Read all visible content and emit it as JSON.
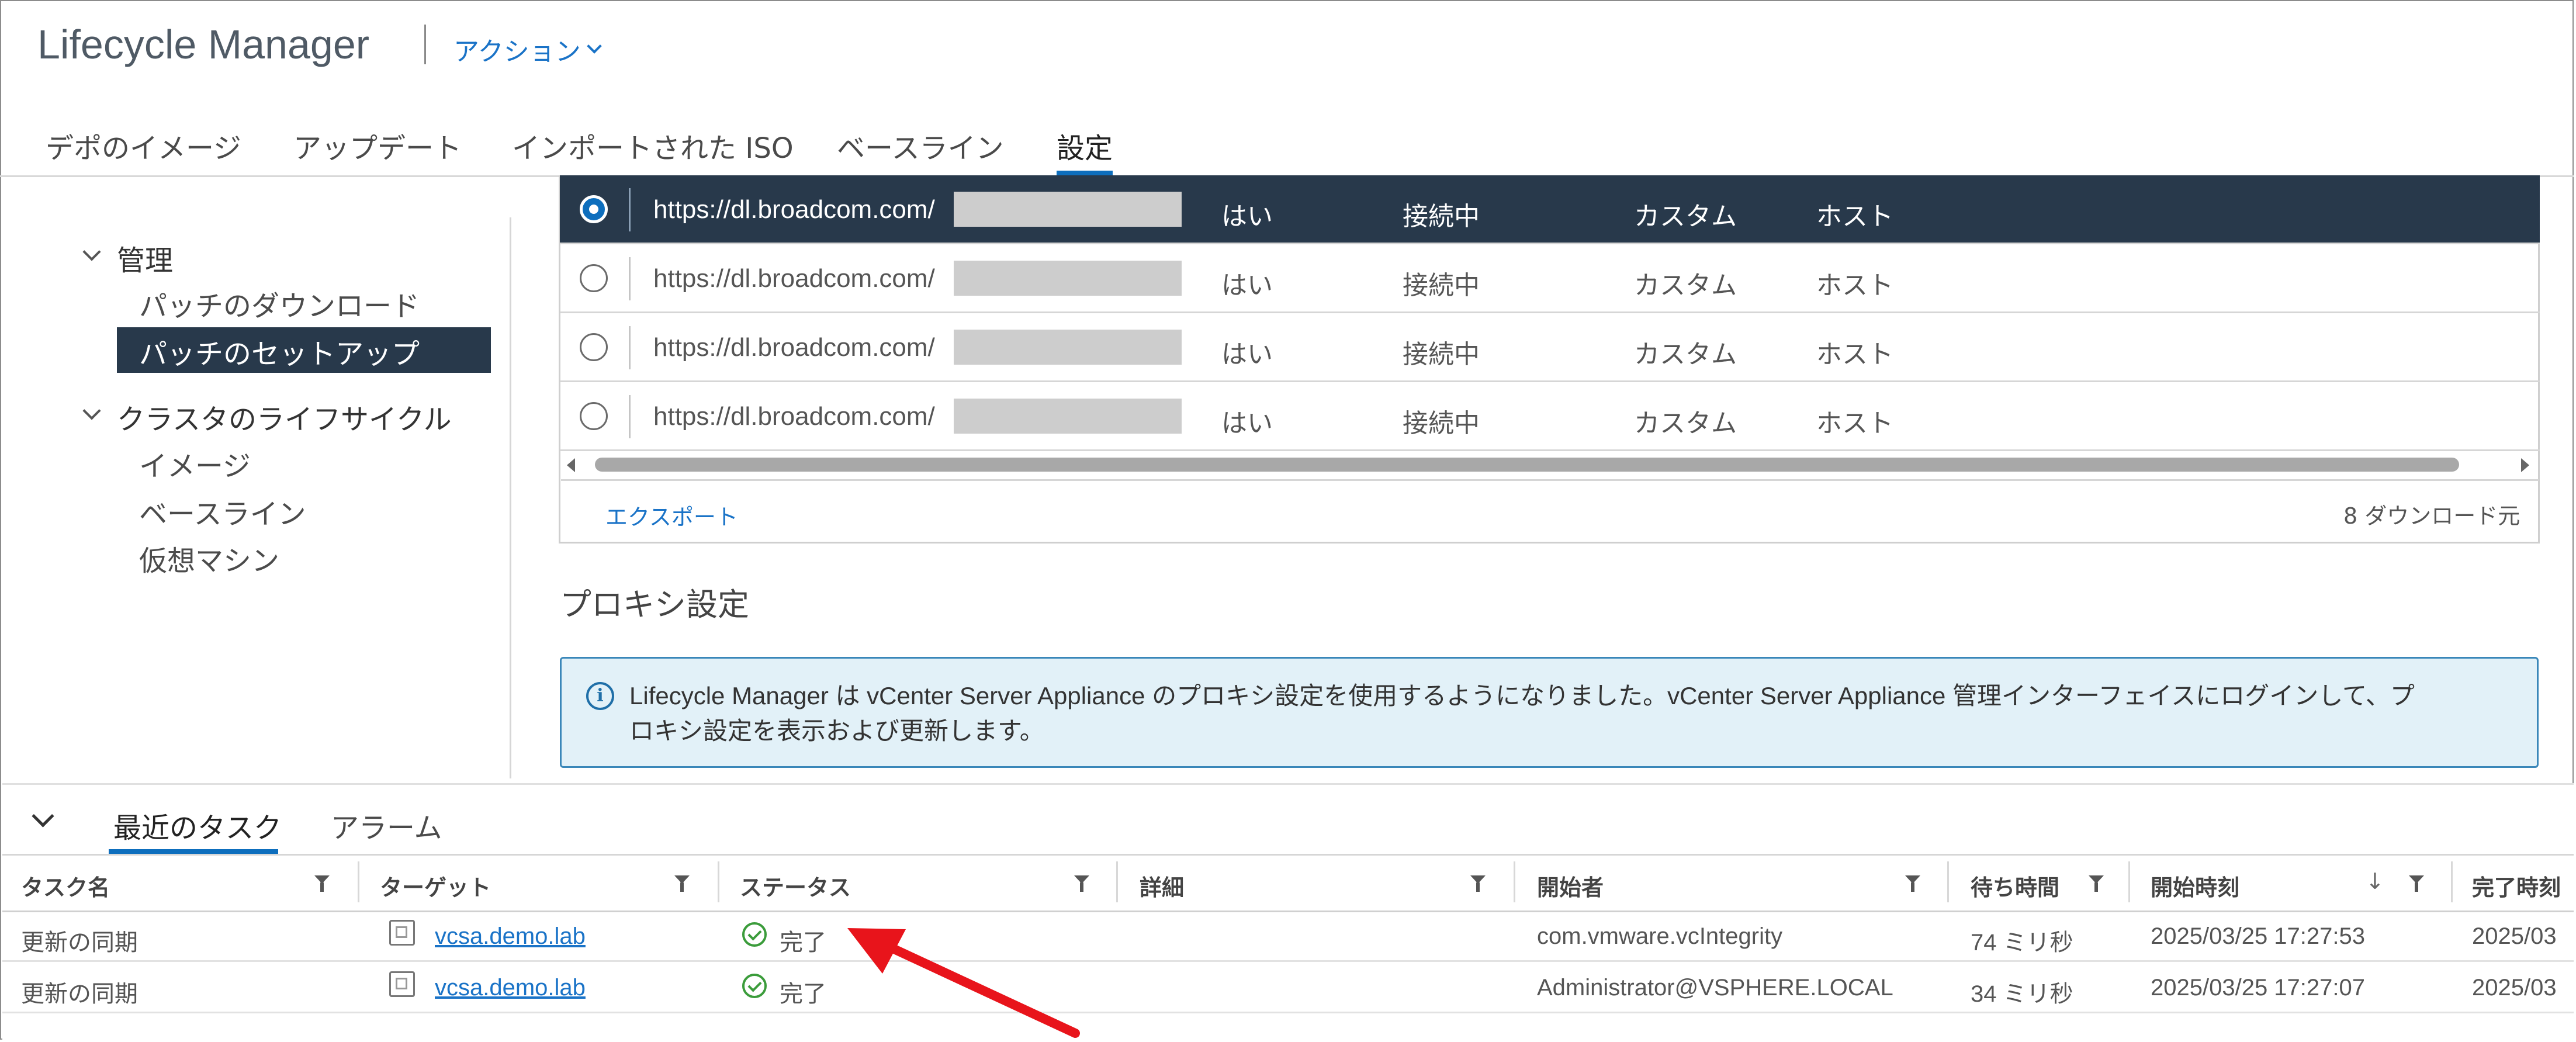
{
  "header": {
    "app_title": "Lifecycle Manager",
    "actions_label": "アクション"
  },
  "tabs": [
    "デポのイメージ",
    "アップデート",
    "インポートされた ISO",
    "ベースライン",
    "設定"
  ],
  "active_tab": "設定",
  "sidebar": {
    "group_admin": "管理",
    "admin_items": [
      "パッチのダウンロード",
      "パッチのセットアップ"
    ],
    "selected_item": "パッチのセットアップ",
    "group_cluster": "クラスタのライフサイクル",
    "cluster_items": [
      "イメージ",
      "ベースライン",
      "仮想マシン"
    ]
  },
  "download_sources": {
    "rows": [
      {
        "url": "https://dl.broadcom.com/",
        "enabled": "はい",
        "status": "接続中",
        "type": "カスタム",
        "content": "ホスト",
        "selected": true
      },
      {
        "url": "https://dl.broadcom.com/",
        "enabled": "はい",
        "status": "接続中",
        "type": "カスタム",
        "content": "ホスト",
        "selected": false
      },
      {
        "url": "https://dl.broadcom.com/",
        "enabled": "はい",
        "status": "接続中",
        "type": "カスタム",
        "content": "ホスト",
        "selected": false
      },
      {
        "url": "https://dl.broadcom.com/",
        "enabled": "はい",
        "status": "接続中",
        "type": "カスタム",
        "content": "ホスト",
        "selected": false
      }
    ],
    "export_label": "エクスポート",
    "count_label": "8 ダウンロード元"
  },
  "proxy": {
    "title": "プロキシ設定",
    "info_line1": "Lifecycle Manager は vCenter Server Appliance のプロキシ設定を使用するようになりました。vCenter Server Appliance 管理インターフェイスにログインして、プ",
    "info_line2": "ロキシ設定を表示および更新します。"
  },
  "bottom_panel": {
    "tabs": [
      "最近のタスク",
      "アラーム"
    ],
    "active_tab": "最近のタスク",
    "columns": [
      "タスク名",
      "ターゲット",
      "ステータス",
      "詳細",
      "開始者",
      "待ち時間",
      "開始時刻",
      "完了時刻"
    ],
    "rows": [
      {
        "task": "更新の同期",
        "target": "vcsa.demo.lab",
        "status": "完了",
        "details": "",
        "initiator": "com.vmware.vcIntegrity",
        "queued": "74 ミリ秒",
        "start": "2025/03/25 17:27:53",
        "end": "2025/03"
      },
      {
        "task": "更新の同期",
        "target": "vcsa.demo.lab",
        "status": "完了",
        "details": "",
        "initiator": "Administrator@VSPHERE.LOCAL",
        "queued": "34 ミリ秒",
        "start": "2025/03/25 17:27:07",
        "end": "2025/03"
      }
    ]
  },
  "colors": {
    "accent": "#0d6ebd",
    "selected_row": "#28394b",
    "link": "#1a73c7",
    "annotation_arrow": "#e8141b",
    "success": "#3b9c3b"
  }
}
